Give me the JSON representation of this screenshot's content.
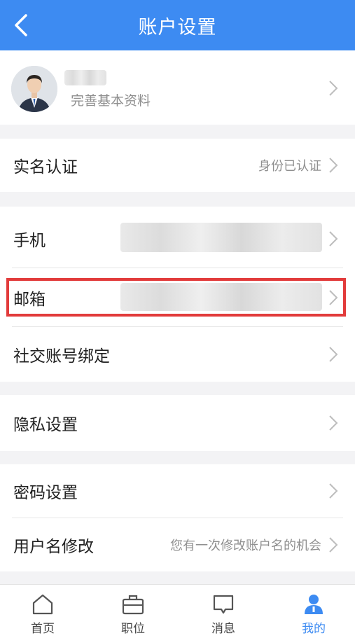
{
  "header": {
    "title": "账户设置",
    "back_icon": "chevron-left-icon"
  },
  "profile": {
    "hint": "完善基本资料",
    "name": "",
    "avatar_icon": "avatar-icon"
  },
  "rows": {
    "realname": {
      "label": "实名认证",
      "value": "身份已认证"
    },
    "phone": {
      "label": "手机",
      "value": ""
    },
    "email": {
      "label": "邮箱",
      "value": ""
    },
    "social": {
      "label": "社交账号绑定"
    },
    "privacy": {
      "label": "隐私设置"
    },
    "password": {
      "label": "密码设置"
    },
    "username": {
      "label": "用户名修改",
      "value": "您有一次修改账户名的机会"
    }
  },
  "tabbar": {
    "items": [
      {
        "label": "首页",
        "icon": "home-icon"
      },
      {
        "label": "职位",
        "icon": "briefcase-icon"
      },
      {
        "label": "消息",
        "icon": "message-icon"
      },
      {
        "label": "我的",
        "icon": "user-icon",
        "active": true
      }
    ]
  },
  "colors": {
    "primary": "#3d8bf2",
    "highlight": "#e23b3b",
    "background": "#f3f3f5"
  }
}
